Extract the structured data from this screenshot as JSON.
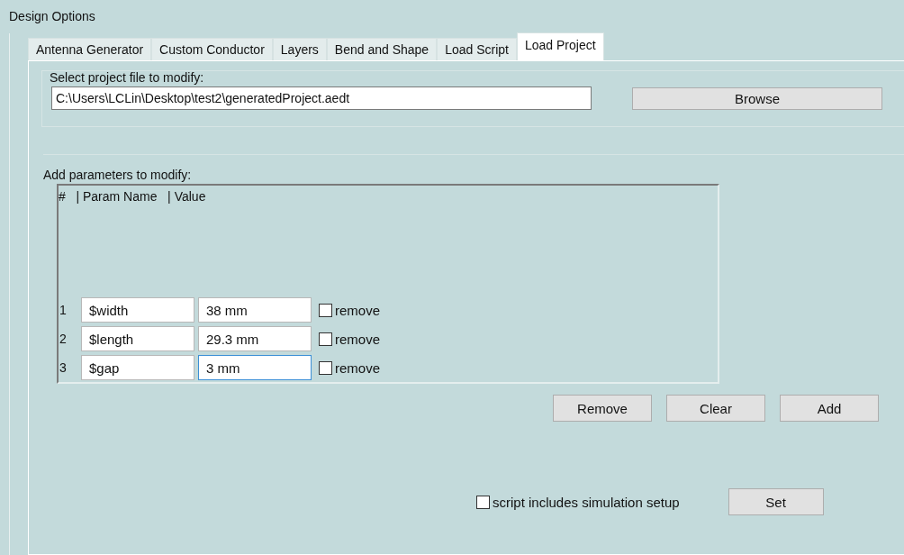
{
  "window": {
    "title": "Design Options"
  },
  "tabs": [
    {
      "label": "Antenna Generator",
      "selected": false
    },
    {
      "label": "Custom Conductor",
      "selected": false
    },
    {
      "label": "Layers",
      "selected": false
    },
    {
      "label": "Bend and Shape",
      "selected": false
    },
    {
      "label": "Load Script",
      "selected": false
    },
    {
      "label": "Load Project",
      "selected": true
    }
  ],
  "project_file": {
    "label": "Select project file to modify:",
    "value": "C:\\Users\\LCLin\\Desktop\\test2\\generatedProject.aedt",
    "browse_button": "Browse"
  },
  "parameters": {
    "label": "Add parameters to modify:",
    "header": "#   | Param Name   | Value",
    "rows": [
      {
        "index": "1",
        "name": "$width",
        "value": "38 mm",
        "focused": false,
        "remove_label": "remove",
        "checked": false
      },
      {
        "index": "2",
        "name": "$length",
        "value": "29.3 mm",
        "focused": false,
        "remove_label": "remove",
        "checked": false
      },
      {
        "index": "3",
        "name": "$gap",
        "value": "3 mm",
        "focused": true,
        "remove_label": "remove",
        "checked": false
      }
    ],
    "buttons": [
      "Remove",
      "Clear",
      "Add"
    ]
  },
  "simulation_setup": {
    "label": "script includes simulation setup",
    "checked": false
  },
  "set_button": "Set"
}
